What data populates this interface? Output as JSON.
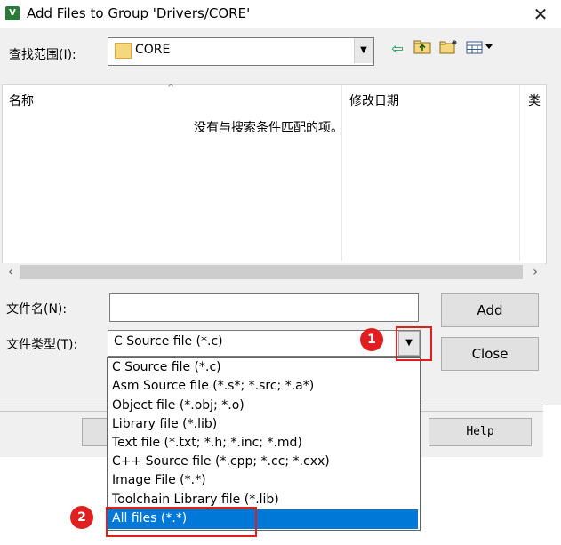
{
  "dialog": {
    "title": "Add Files to Group 'Drivers/CORE'",
    "close_glyph": "✕",
    "look_in_label": "查找范围(I):",
    "look_in_value": "CORE"
  },
  "file_list": {
    "columns": [
      "名称",
      "修改日期",
      "类"
    ],
    "empty_message": "没有与搜索条件匹配的项。"
  },
  "file_name": {
    "label": "文件名(N):",
    "value": ""
  },
  "file_type": {
    "label": "文件类型(T):",
    "value": "C Source file (*.c)",
    "options": [
      "C Source file (*.c)",
      "Asm Source file (*.s*; *.src; *.a*)",
      "Object file (*.obj; *.o)",
      "Library file (*.lib)",
      "Text file (*.txt; *.h; *.inc; *.md)",
      "C++ Source file (*.cpp; *.cc; *.cxx)",
      "Image File (*.*)",
      "Toolchain Library file (*.lib)",
      "All files (*.*)"
    ],
    "highlighted_index": 8
  },
  "buttons": {
    "add": "Add",
    "close": "Close"
  },
  "background": {
    "help_button": "Help"
  },
  "annotations": {
    "badge1": "1",
    "badge2": "2"
  },
  "icons": {
    "app": "keil-uvision-icon",
    "folder": "folder-icon",
    "back": "back-arrow-icon",
    "up": "up-folder-icon",
    "new_folder": "new-folder-icon",
    "view": "view-menu-icon"
  },
  "colors": {
    "selection": "#0078d7",
    "callout": "#e02020",
    "folder": "#f5d77c"
  }
}
